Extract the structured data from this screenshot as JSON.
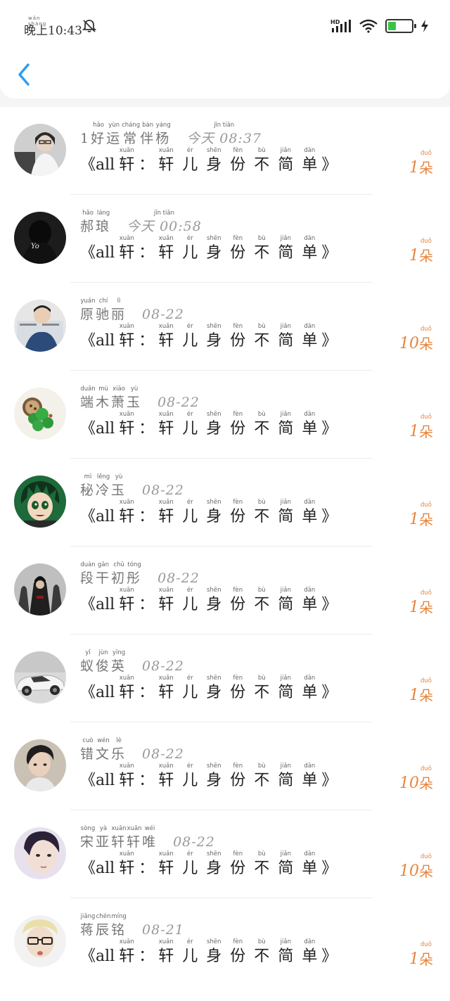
{
  "status_bar": {
    "time_ruby": "wǎn shàng",
    "time": "晚上10:43",
    "network": "HD",
    "battery_level": 0.35
  },
  "header": {
    "back_icon": "chevron-left-icon"
  },
  "colors": {
    "accent": "#2a9df4",
    "count": "#e8843c",
    "name": "#777777"
  },
  "title": [
    {
      "t": "《all"
    },
    {
      "t": "轩",
      "py": "xuān"
    },
    {
      "t": "："
    },
    {
      "t": "轩",
      "py": "xuān"
    },
    {
      "t": "儿",
      "py": "ér"
    },
    {
      "t": "身",
      "py": "shēn"
    },
    {
      "t": "份",
      "py": "fèn"
    },
    {
      "t": "不",
      "py": "bù"
    },
    {
      "t": "简",
      "py": "jiǎn"
    },
    {
      "t": "单",
      "py": "dān"
    },
    {
      "t": "》"
    }
  ],
  "unit": {
    "t": "朵",
    "py": "duǒ"
  },
  "rows": [
    {
      "name": [
        {
          "t": "1"
        },
        {
          "t": "好",
          "py": "hǎo"
        },
        {
          "t": "运",
          "py": "yùn"
        },
        {
          "t": "常",
          "py": "cháng"
        },
        {
          "t": "伴",
          "py": "bàn"
        },
        {
          "t": "杨",
          "py": "yáng"
        }
      ],
      "date": "今天 08:37",
      "date_ruby": "jīn tiān",
      "count": "1",
      "avatar": "girl-laptop"
    },
    {
      "name": [
        {
          "t": "郝",
          "py": "hǎo"
        },
        {
          "t": "琅",
          "py": "láng"
        }
      ],
      "date": "今天 00:58",
      "date_ruby": "jīn tiān",
      "count": "1",
      "avatar": "dark-hooded"
    },
    {
      "name": [
        {
          "t": "原",
          "py": "yuán"
        },
        {
          "t": "驰",
          "py": "chí"
        },
        {
          "t": "丽",
          "py": "lì"
        }
      ],
      "date": "08-22",
      "count": "10",
      "avatar": "man-newspaper"
    },
    {
      "name": [
        {
          "t": "端",
          "py": "duān"
        },
        {
          "t": "木",
          "py": "mù"
        },
        {
          "t": "萧",
          "py": "xiāo"
        },
        {
          "t": "玉",
          "py": "yù"
        }
      ],
      "date": "08-22",
      "count": "1",
      "avatar": "clover"
    },
    {
      "name": [
        {
          "t": "秘",
          "py": "mì"
        },
        {
          "t": "冷",
          "py": "lěng"
        },
        {
          "t": "玉",
          "py": "yù"
        }
      ],
      "date": "08-22",
      "count": "1",
      "avatar": "anime-boy"
    },
    {
      "name": [
        {
          "t": "段",
          "py": "duàn"
        },
        {
          "t": "干",
          "py": "gān"
        },
        {
          "t": "初",
          "py": "chū"
        },
        {
          "t": "彤",
          "py": "tóng"
        }
      ],
      "date": "08-22",
      "count": "1",
      "avatar": "assassins"
    },
    {
      "name": [
        {
          "t": "蚁",
          "py": "yǐ"
        },
        {
          "t": "俊",
          "py": "jùn"
        },
        {
          "t": "英",
          "py": "yīng"
        }
      ],
      "date": "08-22",
      "count": "1",
      "avatar": "white-car"
    },
    {
      "name": [
        {
          "t": "错",
          "py": "cuò"
        },
        {
          "t": "文",
          "py": "wén"
        },
        {
          "t": "乐",
          "py": "lè"
        }
      ],
      "date": "08-22",
      "count": "10",
      "avatar": "boy-portrait"
    },
    {
      "name": [
        {
          "t": "宋",
          "py": "sòng"
        },
        {
          "t": "亚",
          "py": "yà"
        },
        {
          "t": "轩",
          "py": "xuān"
        },
        {
          "t": "轩",
          "py": "xuān"
        },
        {
          "t": "唯",
          "py": "wéi"
        }
      ],
      "date": "08-22",
      "count": "10",
      "avatar": "soft-face"
    },
    {
      "name": [
        {
          "t": "蒋",
          "py": "jiǎng"
        },
        {
          "t": "辰",
          "py": "chén"
        },
        {
          "t": "铭",
          "py": "míng"
        }
      ],
      "date": "08-21",
      "count": "1",
      "avatar": "glasses-boy"
    }
  ]
}
